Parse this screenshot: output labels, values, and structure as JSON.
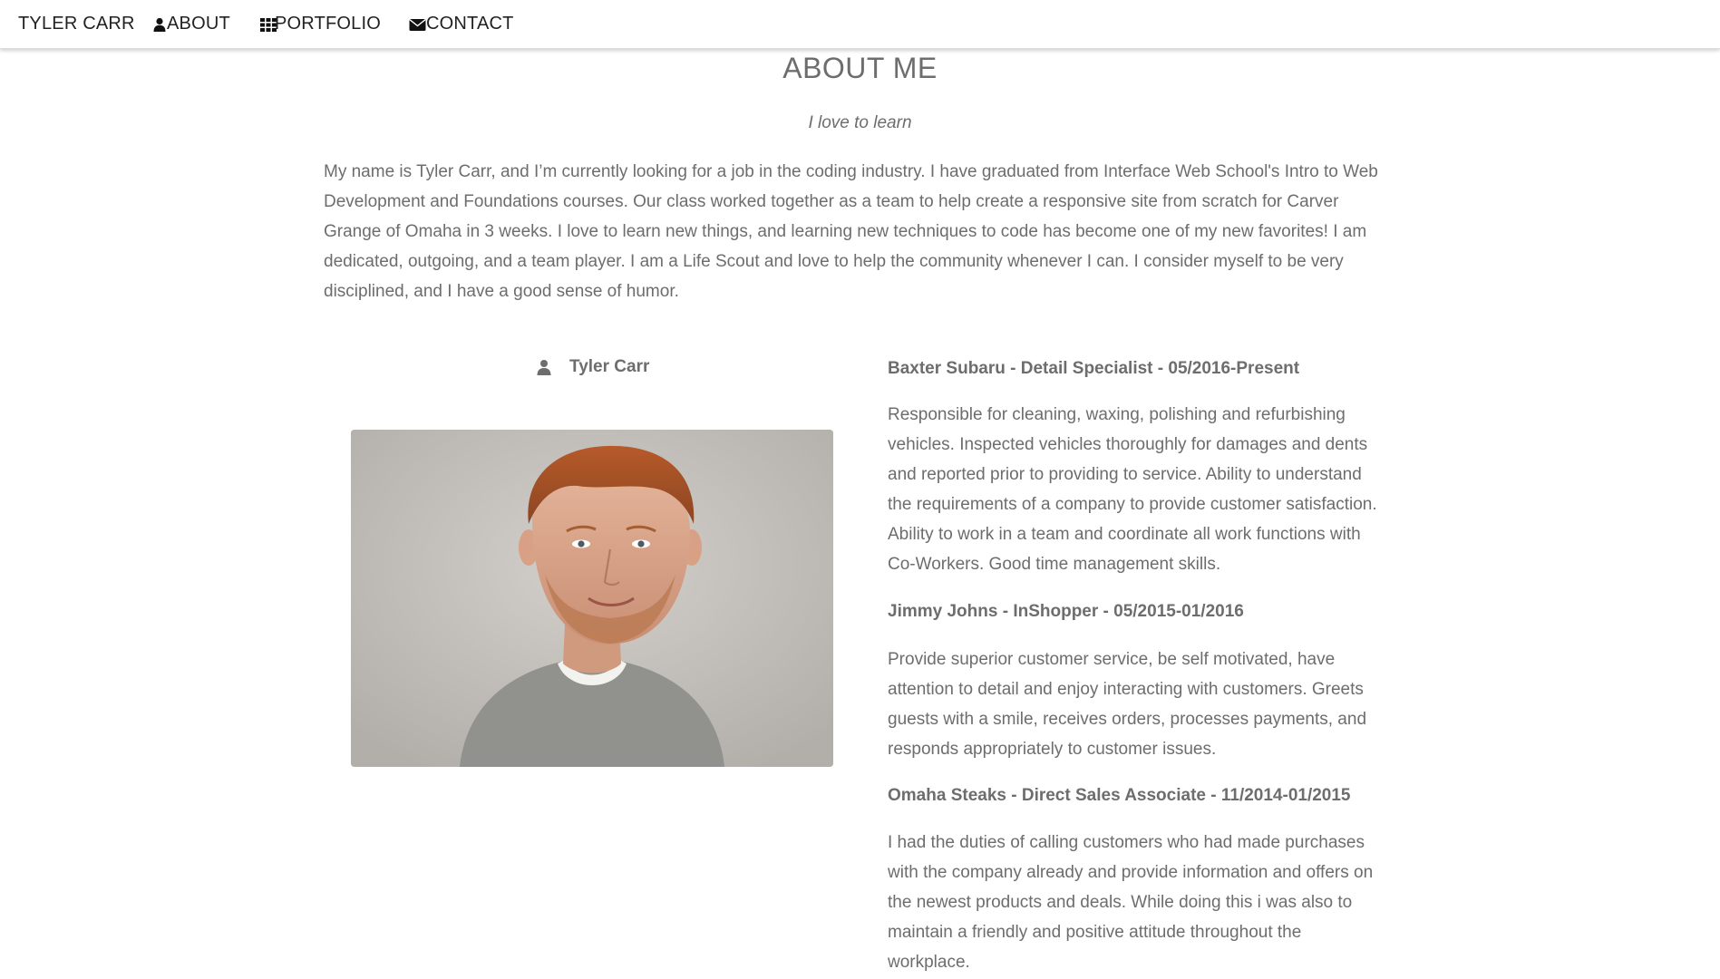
{
  "navbar": {
    "brand": "TYLER CARR",
    "items": [
      {
        "label": "ABOUT",
        "icon": "user-icon"
      },
      {
        "label": "PORTFOLIO",
        "icon": "grid-icon"
      },
      {
        "label": "CONTACT",
        "icon": "envelope-icon"
      }
    ]
  },
  "about": {
    "heading": "ABOUT ME",
    "tagline": "I love to learn",
    "intro": "My name is Tyler Carr, and I’m currently looking for a job in the coding industry. I have graduated from Interface Web School's Intro to Web Development and Foundations courses. Our class worked together as a team to help create a responsive site from scratch for Carver Grange of Omaha in 3 weeks. I love to learn new things, and learning new techniques to code has become one of my new favorites! I am dedicated, outgoing, and a team player. I am a Life Scout and love to help the community whenever I can. I consider myself to be very disciplined, and I have a good sense of humor."
  },
  "profile": {
    "name": "Tyler Carr",
    "icon": "user-icon"
  },
  "jobs": [
    {
      "title": "Baxter Subaru - Detail Specialist - 05/2016-Present",
      "description": "Responsible for cleaning, waxing, polishing and refurbishing vehicles. Inspected vehicles thoroughly for damages and dents and reported prior to providing to service. Ability to understand the requirements of a company to provide customer satisfaction. Ability to work in a team and coordinate all work functions with Co-Workers. Good time management skills."
    },
    {
      "title": "Jimmy Johns - InShopper - 05/2015-01/2016",
      "description": "Provide superior customer service, be self motivated, have attention to detail and enjoy interacting with customers. Greets guests with a smile, receives orders, processes payments, and responds appropriately to customer issues."
    },
    {
      "title": "Omaha Steaks - Direct Sales Associate - 11/2014-01/2015",
      "description": "I had the duties of calling customers who had made purchases with the company already and provide information and offers on the newest products and deals. While doing this i was also to maintain a friendly and positive attitude throughout the workplace."
    }
  ],
  "colors": {
    "text": "#6d6d6d",
    "nav_text": "#222222",
    "background": "#ffffff"
  }
}
